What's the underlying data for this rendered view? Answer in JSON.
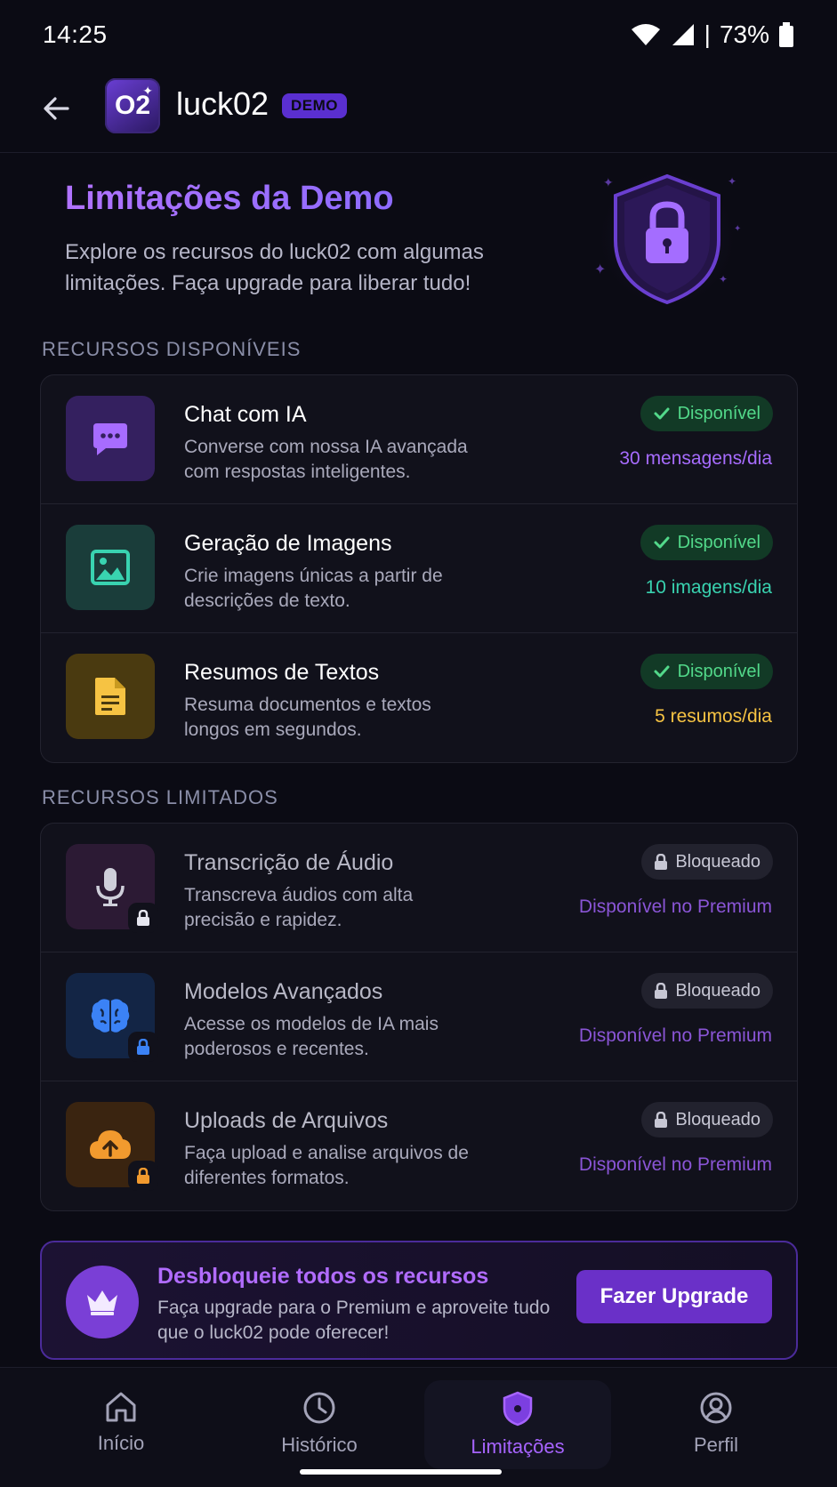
{
  "status_bar": {
    "time": "14:25",
    "battery": "73%"
  },
  "header": {
    "app_name": "luck02",
    "logo_text": "O2",
    "badge": "DEMO"
  },
  "hero": {
    "title": "Limitações da Demo",
    "description": "Explore os recursos do luck02 com algumas limitações. Faça upgrade para liberar tudo!"
  },
  "available": {
    "section_title": "RECURSOS DISPONÍVEIS",
    "items": [
      {
        "title": "Chat com IA",
        "description": "Converse com nossa IA avançada com respostas inteligentes.",
        "status": "Disponível",
        "quota": "30 mensagens/dia",
        "icon": "chat-icon",
        "color": "#a76cff"
      },
      {
        "title": "Geração de Imagens",
        "description": "Crie imagens únicas a partir de descrições de texto.",
        "status": "Disponível",
        "quota": "10 imagens/dia",
        "icon": "image-icon",
        "color": "#39d3b0"
      },
      {
        "title": "Resumos de Textos",
        "description": "Resuma documentos e textos longos em segundos.",
        "status": "Disponível",
        "quota": "5 resumos/dia",
        "icon": "document-icon",
        "color": "#f6c343"
      }
    ]
  },
  "limited": {
    "section_title": "RECURSOS LIMITADOS",
    "items": [
      {
        "title": "Transcrição de Áudio",
        "description": "Transcreva áudios com alta precisão e rapidez.",
        "status": "Bloqueado",
        "note": "Disponível no Premium",
        "icon": "microphone-icon",
        "color": "#d0d0dc"
      },
      {
        "title": "Modelos Avançados",
        "description": "Acesse os modelos de IA mais poderosos e recentes.",
        "status": "Bloqueado",
        "note": "Disponível no Premium",
        "icon": "brain-icon",
        "color": "#3b82f6"
      },
      {
        "title": "Uploads de Arquivos",
        "description": "Faça upload e analise arquivos de diferentes formatos.",
        "status": "Bloqueado",
        "note": "Disponível no Premium",
        "icon": "cloud-upload-icon",
        "color": "#f29a2e"
      }
    ]
  },
  "upgrade": {
    "title": "Desbloqueie todos os recursos",
    "description": "Faça upgrade para o Premium e aproveite tudo que o luck02 pode oferecer!",
    "button": "Fazer Upgrade"
  },
  "nav": {
    "items": [
      {
        "label": "Início",
        "icon": "home-icon"
      },
      {
        "label": "Histórico",
        "icon": "history-icon"
      },
      {
        "label": "Limitações",
        "icon": "shield-icon",
        "active": true
      },
      {
        "label": "Perfil",
        "icon": "profile-icon"
      }
    ]
  }
}
